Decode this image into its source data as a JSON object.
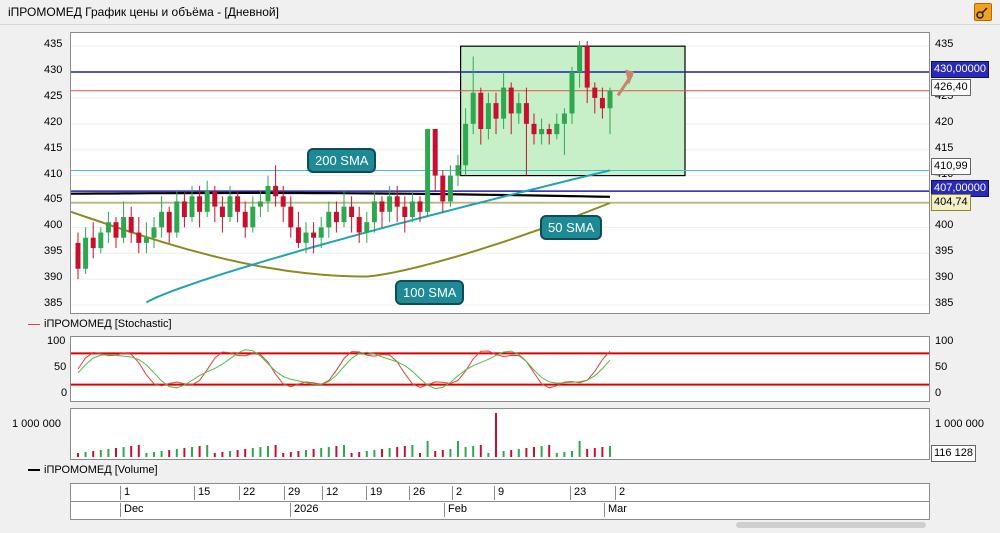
{
  "window": {
    "title": "iПРОМОМЕД График цены и объёма - [Дневной]"
  },
  "colors": {
    "up": "#2ea84e",
    "down": "#c8102e",
    "sma50": "#1fa3b5",
    "sma100": "#8d8a22",
    "sma200": "#000000",
    "level430": "#2020b0",
    "level407": "#2020b0",
    "last": "#e05050",
    "sma50level": "#40c0c8",
    "box": "#c8f0c8",
    "stochK": "#e04040",
    "stochD": "#4bbf4b",
    "stochBand": "#e00000"
  },
  "price_pane": {
    "y_ticks": [
      "435",
      "430",
      "425",
      "420",
      "415",
      "410",
      "405",
      "400",
      "395",
      "390",
      "385"
    ],
    "tags": {
      "level430": "430,00000",
      "last": "426,40",
      "sma50": "410,99",
      "level407": "407,00000",
      "sma100": "404,74"
    },
    "callouts": {
      "sma200": "200 SMA",
      "sma50": "50 SMA",
      "sma100": "100 SMA"
    }
  },
  "stoch_pane": {
    "legend": "iПРОМОМЕД [Stochastic]",
    "y_ticks": [
      "100",
      "50",
      "0"
    ]
  },
  "volume_pane": {
    "legend": "iПРОМОМЕД [Volume]",
    "y_tick": "1 000 000",
    "right_ticks": {
      "top": "1 000 000",
      "last": "116 128"
    }
  },
  "time_axis": {
    "days": [
      "1",
      "15",
      "22",
      "29",
      "12",
      "19",
      "26",
      "2",
      "9",
      "23",
      "2"
    ],
    "months": [
      "Dec",
      "2026",
      "Feb",
      "Mar"
    ]
  },
  "chart_data": {
    "type": "candlestick",
    "ylim": [
      385,
      436
    ],
    "last_price": 426.4,
    "horizontal_levels": [
      430.0,
      407.0
    ],
    "sma50_last": 410.99,
    "sma100_last": 404.74,
    "highlight_box": {
      "y_range": [
        410.0,
        435.0
      ]
    },
    "candles": [
      [
        397.0,
        392.0,
        390.0,
        399.0
      ],
      [
        392.0,
        398.0,
        391.0,
        400.0
      ],
      [
        398.0,
        396.0,
        394.0,
        401.0
      ],
      [
        396.0,
        399.0,
        395.0,
        400.0
      ],
      [
        399.0,
        401.0,
        397.0,
        403.0
      ],
      [
        401.0,
        398.0,
        396.0,
        402.0
      ],
      [
        398.0,
        402.0,
        397.0,
        405.0
      ],
      [
        402.0,
        399.0,
        397.0,
        404.0
      ],
      [
        399.0,
        397.0,
        395.0,
        402.0
      ],
      [
        397.0,
        398.0,
        395.0,
        401.0
      ],
      [
        398.0,
        400.0,
        396.0,
        402.0
      ],
      [
        400.0,
        403.0,
        398.0,
        406.0
      ],
      [
        403.0,
        399.0,
        397.0,
        404.0
      ],
      [
        399.0,
        405.0,
        398.0,
        407.0
      ],
      [
        405.0,
        402.0,
        400.0,
        407.0
      ],
      [
        402.0,
        406.0,
        401.0,
        408.0
      ],
      [
        406.0,
        403.0,
        400.0,
        408.0
      ],
      [
        403.0,
        407.0,
        402.0,
        409.0
      ],
      [
        407.0,
        404.0,
        401.0,
        408.0
      ],
      [
        404.0,
        402.0,
        399.0,
        406.0
      ],
      [
        402.0,
        406.0,
        401.0,
        408.0
      ],
      [
        406.0,
        403.0,
        401.0,
        407.0
      ],
      [
        403.0,
        400.0,
        398.0,
        405.0
      ],
      [
        400.0,
        404.0,
        399.0,
        406.0
      ],
      [
        404.0,
        405.0,
        402.0,
        407.0
      ],
      [
        405.0,
        408.0,
        403.0,
        410.0
      ],
      [
        408.0,
        406.0,
        404.0,
        412.0
      ],
      [
        406.0,
        404.0,
        401.0,
        408.0
      ],
      [
        404.0,
        400.0,
        398.0,
        406.0
      ],
      [
        400.0,
        397.0,
        396.0,
        403.0
      ],
      [
        397.0,
        399.0,
        395.0,
        401.0
      ],
      [
        399.0,
        398.0,
        395.0,
        401.0
      ],
      [
        398.0,
        400.0,
        396.0,
        402.0
      ],
      [
        400.0,
        403.0,
        398.0,
        405.0
      ],
      [
        403.0,
        401.0,
        399.0,
        405.0
      ],
      [
        401.0,
        404.0,
        400.0,
        407.0
      ],
      [
        404.0,
        402.0,
        399.0,
        406.0
      ],
      [
        402.0,
        399.0,
        397.0,
        404.0
      ],
      [
        399.0,
        401.0,
        397.0,
        403.0
      ],
      [
        401.0,
        405.0,
        399.0,
        407.0
      ],
      [
        405.0,
        403.0,
        400.0,
        406.0
      ],
      [
        403.0,
        406.0,
        401.0,
        408.0
      ],
      [
        406.0,
        404.0,
        401.0,
        408.0
      ],
      [
        404.0,
        402.0,
        399.0,
        406.0
      ],
      [
        402.0,
        405.0,
        401.0,
        407.0
      ],
      [
        405.0,
        403.0,
        401.0,
        406.0
      ],
      [
        403.0,
        419.0,
        402.0,
        419.0
      ],
      [
        419.0,
        410.0,
        407.0,
        419.0
      ],
      [
        410.0,
        405.0,
        403.0,
        411.0
      ],
      [
        405.0,
        410.0,
        404.0,
        412.0
      ],
      [
        410.0,
        412.0,
        408.0,
        414.0
      ],
      [
        412.0,
        420.0,
        410.0,
        423.0
      ],
      [
        420.0,
        426.0,
        418.0,
        433.0
      ],
      [
        426.0,
        419.0,
        416.0,
        427.0
      ],
      [
        419.0,
        424.0,
        417.0,
        426.0
      ],
      [
        424.0,
        421.0,
        418.0,
        426.0
      ],
      [
        421.0,
        427.0,
        419.0,
        430.0
      ],
      [
        427.0,
        422.0,
        418.0,
        428.0
      ],
      [
        422.0,
        424.0,
        420.0,
        426.0
      ],
      [
        424.0,
        420.0,
        410.0,
        427.0
      ],
      [
        420.0,
        418.0,
        416.0,
        422.0
      ],
      [
        418.0,
        419.0,
        416.0,
        421.0
      ],
      [
        419.0,
        418.0,
        416.0,
        420.0
      ],
      [
        418.0,
        420.0,
        417.0,
        422.0
      ],
      [
        420.0,
        422.0,
        414.0,
        423.0
      ],
      [
        422.0,
        430.0,
        420.0,
        431.0
      ],
      [
        430.0,
        435.0,
        427.0,
        436.0
      ],
      [
        435.0,
        427.0,
        424.0,
        436.0
      ],
      [
        427.0,
        425.0,
        422.0,
        428.0
      ],
      [
        425.0,
        423.0,
        421.0,
        427.0
      ],
      [
        423.0,
        426.4,
        418.0,
        427.0
      ]
    ]
  }
}
